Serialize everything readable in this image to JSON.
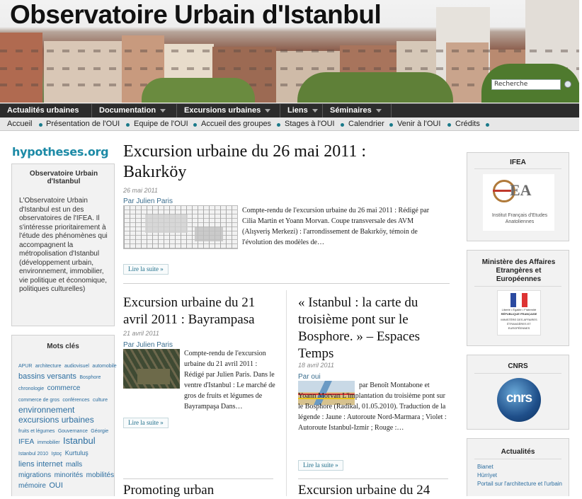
{
  "site": {
    "title": "Observatoire Urbain d'Istanbul",
    "search_placeholder": "Recherche"
  },
  "main_nav": [
    {
      "label": "Actualités urbaines",
      "has_menu": false
    },
    {
      "label": "Documentation",
      "has_menu": true
    },
    {
      "label": "Excursions urbaines",
      "has_menu": true
    },
    {
      "label": "Liens",
      "has_menu": true
    },
    {
      "label": "Séminaires",
      "has_menu": true
    }
  ],
  "sub_nav": [
    "Accueil",
    "Présentation de l'OUI",
    "Equipe de l'OUI",
    "Accueil des groupes",
    "Stages à l'OUI",
    "Calendrier",
    "Venir à l'OUI",
    "Crédits"
  ],
  "left_sidebar": {
    "logo_text": "hypotheses.org",
    "about": {
      "title": "Observatoire Urbain d'Istanbul",
      "text": "L'Observatoire Urbain d'Istanbul est un des observatoires de l'IFEA. Il s'intéresse prioritairement à l'étude des phénomènes qui accompagnent la métropolisation d'Istanbul (développement urbain, environnement, immobilier, vie politique et économique, politiques culturelles)"
    },
    "tags": {
      "title": "Mots clés",
      "items": [
        {
          "label": "APUR",
          "size": 7
        },
        {
          "label": "architecture",
          "size": 7
        },
        {
          "label": "audiovisuel",
          "size": 7
        },
        {
          "label": "automobile",
          "size": 7
        },
        {
          "label": "bassins versants",
          "size": 11
        },
        {
          "label": "Bosphore",
          "size": 7
        },
        {
          "label": "chronologie",
          "size": 7
        },
        {
          "label": "commerce",
          "size": 10
        },
        {
          "label": "commerce de gros",
          "size": 7
        },
        {
          "label": "conférences",
          "size": 7
        },
        {
          "label": "culture",
          "size": 7
        },
        {
          "label": "environnement",
          "size": 12
        },
        {
          "label": "excursions urbaines",
          "size": 12
        },
        {
          "label": "fruits et légumes",
          "size": 7
        },
        {
          "label": "Gouvernance",
          "size": 7
        },
        {
          "label": "Géorgie",
          "size": 7
        },
        {
          "label": "IFEA",
          "size": 10
        },
        {
          "label": "immobilier",
          "size": 7
        },
        {
          "label": "Istanbul",
          "size": 13
        },
        {
          "label": "Istanbul 2010",
          "size": 7
        },
        {
          "label": "Iştoç",
          "size": 7
        },
        {
          "label": "Kurtuluş",
          "size": 9
        },
        {
          "label": "liens internet",
          "size": 11
        },
        {
          "label": "malls",
          "size": 10
        },
        {
          "label": "migrations",
          "size": 10
        },
        {
          "label": "minorités",
          "size": 10
        },
        {
          "label": "mobilités",
          "size": 10
        },
        {
          "label": "mémoire",
          "size": 10
        },
        {
          "label": "OUI",
          "size": 11
        }
      ]
    }
  },
  "posts": [
    {
      "title": "Excursion urbaine du 26 mai 2011 : Bakırköy",
      "date": "26 mai 2011",
      "author": "Par Julien Paris",
      "excerpt": "Compte-rendu de l'excursion urbaine du 26 mai 2011 : Rédigé par Cilia Martin et Yoann Morvan. Coupe transversale des AVM (Alışveriş Merkezi) : l'arrondissement de Bakırköy, témoin de l'évolution des modèles de…",
      "more": "Lire la suite »"
    },
    {
      "title": "Excursion urbaine du 21 avril 2011 : Bayrampasa",
      "date": "21 avril 2011",
      "author": "Par Julien Paris",
      "excerpt": "Compte-rendu de l'excursion urbaine du 21 avril 2011 : Rédigé par Julien Paris. Dans le ventre d'Istanbul : Le marché de gros de fruits et légumes de Bayrampaşa  Dans…",
      "more": "Lire la suite »"
    },
    {
      "title": "« Istanbul : la carte du troisième pont sur le Bosphore. » – Espaces Temps",
      "date": "18 avril 2011",
      "author": "Par oui",
      "excerpt": "par Benoît Montabone et Yoann Morvan L'implantation du troisième pont sur le Bosphore (Radikal, 01.05.2010). Traduction de la légende : Jaune : Autoroute Nord-Marmara ; Violet : Autoroute Istanbul-Izmir ; Rouge :…",
      "more": "Lire la suite »"
    },
    {
      "title": "Promoting urban"
    },
    {
      "title": "Excursion urbaine du 24"
    }
  ],
  "right_sidebar": {
    "ifea": {
      "title": "IFEA",
      "logo_caption": "Institut Français d'Etudes Anatoliennes"
    },
    "ministere": {
      "title": "Ministère des Affaires Etrangères et Européennes",
      "logo_line1": "Liberté • Égalité • Fraternité",
      "logo_line2": "RÉPUBLIQUE FRANÇAISE",
      "logo_line3": "MINISTÈRE DES AFFAIRES ÉTRANGÈRES ET EUROPÉENNES"
    },
    "cnrs": {
      "title": "CNRS",
      "logo_text": "cnrs"
    },
    "actualites": {
      "title": "Actualités",
      "links": [
        "Bianet",
        "Hürriyet",
        "Portail sur l'architecture et l'urbain"
      ]
    }
  },
  "colors": {
    "accent": "#1c8aa6",
    "nav_bg": "#2c2c2c",
    "link": "#2c6ea0"
  }
}
